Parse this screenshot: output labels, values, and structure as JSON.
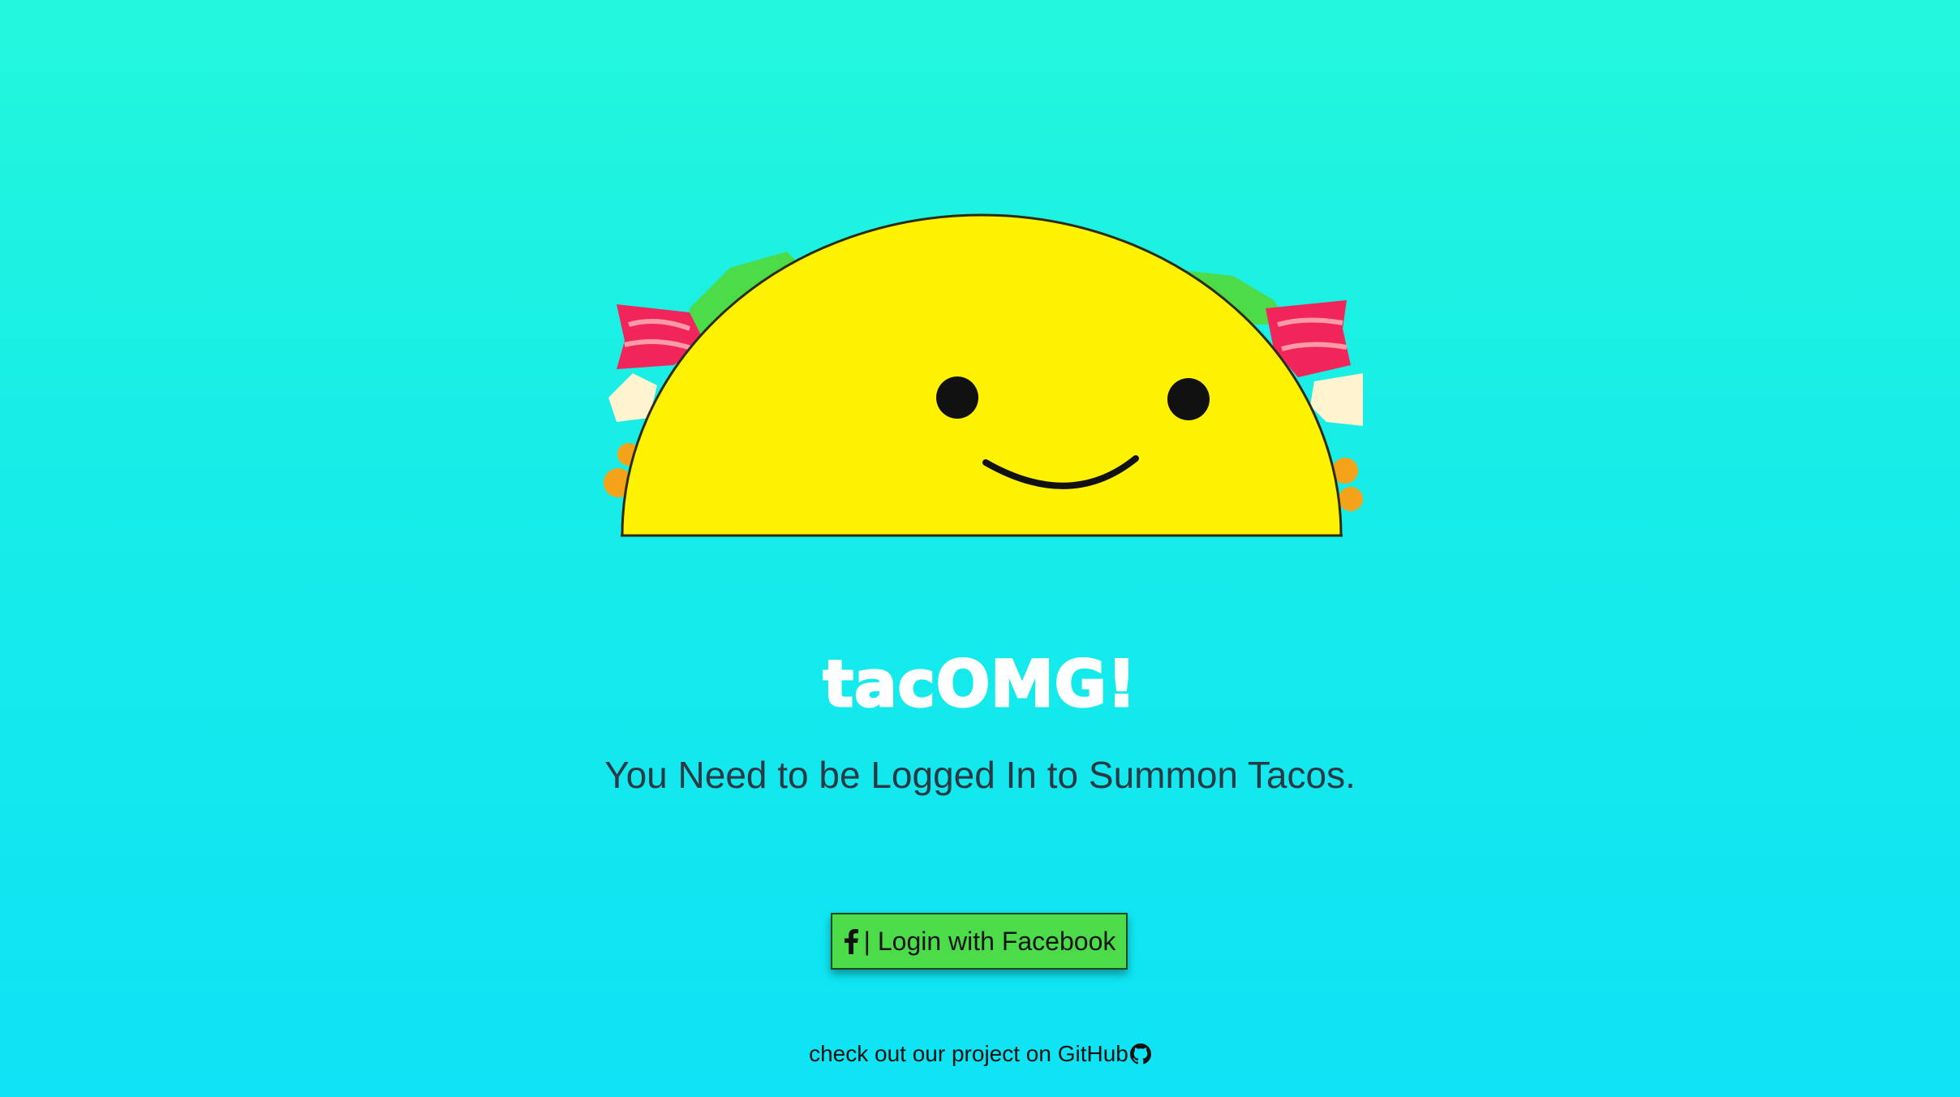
{
  "app": {
    "title": "tacOMG!",
    "subtitle": "You Need to be Logged In to Summon Tacos."
  },
  "login": {
    "icon": "facebook-icon",
    "label": "| Login with Facebook",
    "color": "#4cdc4a"
  },
  "footer": {
    "prefix": "check out our project on ",
    "link_text": "GitHub",
    "icon": "github-icon"
  },
  "colors": {
    "background_top": "#23f7dc",
    "background_bottom": "#0de3f5",
    "taco_shell": "#fff200",
    "taco_shell_back": "#d9d21a",
    "lettuce": "#4cdc4a",
    "bacon": "#f2255a"
  }
}
